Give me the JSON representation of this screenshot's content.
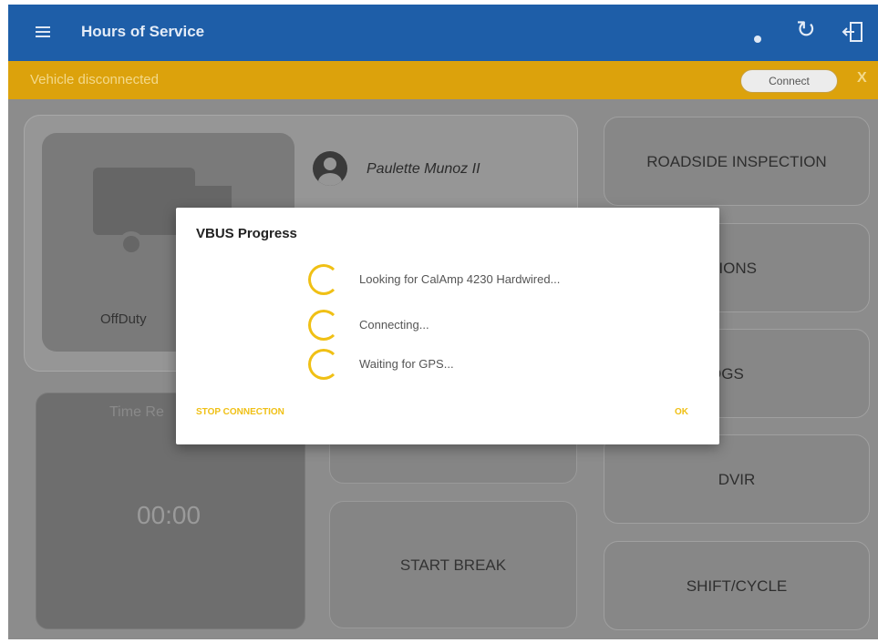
{
  "header": {
    "title": "Hours of Service"
  },
  "banner": {
    "text": "Vehicle disconnected",
    "connect_label": "Connect",
    "close_label": "X"
  },
  "status": {
    "label": "OffDuty"
  },
  "driver": {
    "name": "Paulette Munoz II"
  },
  "timer": {
    "label": "Time Re",
    "value": "00:00"
  },
  "middle_buttons": {
    "start_break": "START BREAK"
  },
  "right_buttons": {
    "roadside": "ROADSIDE INSPECTION",
    "options": "TIONS",
    "logs": "OGS",
    "dvir": "DVIR",
    "shift_cycle": "SHIFT/CYCLE"
  },
  "dialog": {
    "title": "VBUS Progress",
    "steps": [
      "Looking for CalAmp 4230 Hardwired...",
      "Connecting...",
      "Waiting for GPS..."
    ],
    "stop_label": "STOP CONNECTION",
    "ok_label": "OK"
  },
  "colors": {
    "header": "#1e5ea8",
    "banner": "#dca20c",
    "accent": "#f0c015"
  },
  "icons": [
    "menu-icon",
    "bluetooth-icon",
    "refresh-icon",
    "logout-icon",
    "truck-icon",
    "driver-avatar-icon",
    "spinner-icon"
  ]
}
